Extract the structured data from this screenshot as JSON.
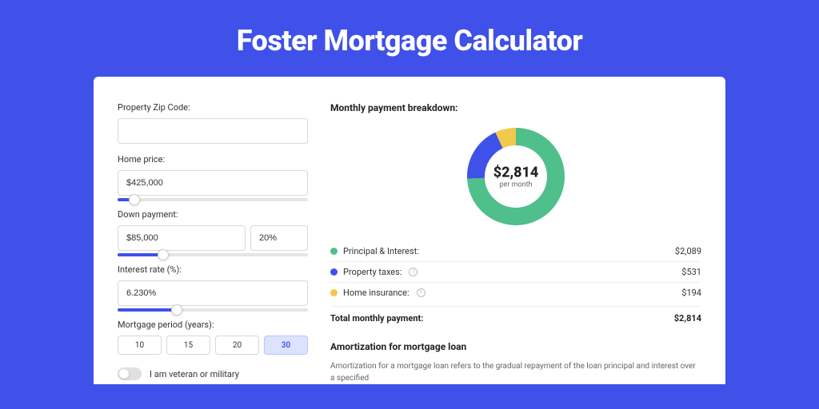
{
  "page": {
    "title": "Foster Mortgage Calculator"
  },
  "form": {
    "zip": {
      "label": "Property Zip Code:",
      "value": ""
    },
    "price": {
      "label": "Home price:",
      "value": "$425,000",
      "slider_pct": 9
    },
    "down": {
      "label": "Down payment:",
      "amount": "$85,000",
      "percent": "20%",
      "slider_pct": 24
    },
    "rate": {
      "label": "Interest rate (%):",
      "value": "6.230%",
      "slider_pct": 31
    },
    "period": {
      "label": "Mortgage period (years):",
      "options": [
        "10",
        "15",
        "20",
        "30"
      ],
      "active": "30"
    },
    "veteran": {
      "label": "I am veteran or military",
      "on": false
    }
  },
  "breakdown": {
    "title": "Monthly payment breakdown:",
    "total": "$2,814",
    "sub": "per month",
    "items": [
      {
        "label": "Principal & Interest:",
        "value": "$2,089",
        "color": "#4FBF8B",
        "info": false
      },
      {
        "label": "Property taxes:",
        "value": "$531",
        "color": "#3F51E8",
        "info": true
      },
      {
        "label": "Home insurance:",
        "value": "$194",
        "color": "#F2C94C",
        "info": true
      }
    ],
    "total_row": {
      "label": "Total monthly payment:",
      "value": "$2,814"
    }
  },
  "amort": {
    "title": "Amortization for mortgage loan",
    "text": "Amortization for a mortgage loan refers to the gradual repayment of the loan principal and interest over a specified"
  },
  "chart_data": {
    "type": "pie",
    "title": "Monthly payment breakdown",
    "series": [
      {
        "name": "Principal & Interest",
        "value": 2089,
        "color": "#4FBF8B"
      },
      {
        "name": "Property taxes",
        "value": 531,
        "color": "#3F51E8"
      },
      {
        "name": "Home insurance",
        "value": 194,
        "color": "#F2C94C"
      }
    ],
    "total": 2814,
    "center_label": "$2,814",
    "center_sub": "per month"
  }
}
